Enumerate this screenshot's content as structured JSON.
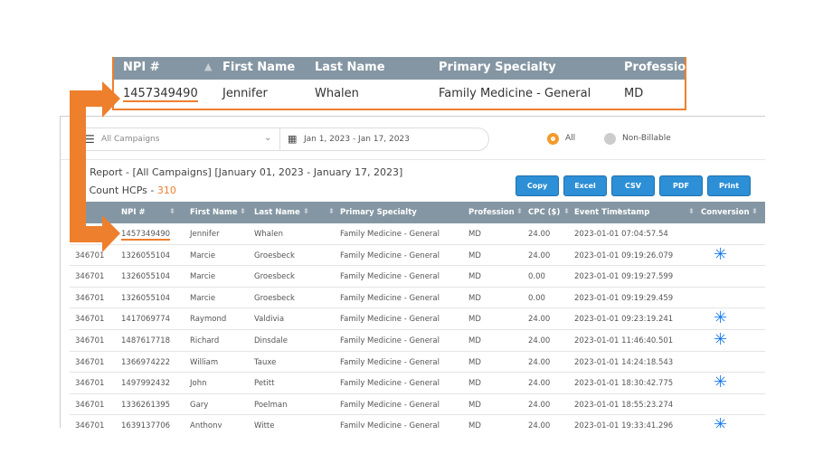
{
  "callout": {
    "headers": [
      "NPI #",
      "First Name",
      "Last Name",
      "Primary Specialty",
      "Profession"
    ],
    "row": {
      "npi": "1457349490",
      "first": "Jennifer",
      "last": "Whalen",
      "specialty": "Family Medicine - General",
      "profession": "MD"
    }
  },
  "filters": {
    "campaign": "All Campaigns",
    "date_range": "Jan 1, 2023 - Jan 17, 2023",
    "radio_all": "All",
    "radio_nonbillable": "Non-Billable",
    "selected": "All"
  },
  "report": {
    "title": "LD Report - [All Campaigns] [January 01, 2023 - January 17, 2023]",
    "count_label": "tal Count HCPs - ",
    "count_value": "310"
  },
  "buttons": [
    "Copy",
    "Excel",
    "CSV",
    "PDF",
    "Print"
  ],
  "table": {
    "headers": [
      "ID",
      "NPI #",
      "First Name",
      "Last Name",
      "Primary Specialty",
      "Profession",
      "CPC ($)",
      "Event Timestamp",
      "Conversion"
    ],
    "rows": [
      {
        "id": "",
        "npi": "1457349490",
        "first": "Jennifer",
        "last": "Whalen",
        "spec": "Family Medicine - General",
        "prof": "MD",
        "cpc": "24.00",
        "ts": "2023-01-01 07:04:57.54",
        "conv": false
      },
      {
        "id": "346701",
        "npi": "1326055104",
        "first": "Marcie",
        "last": "Groesbeck",
        "spec": "Family Medicine - General",
        "prof": "MD",
        "cpc": "24.00",
        "ts": "2023-01-01 09:19:26.079",
        "conv": true
      },
      {
        "id": "346701",
        "npi": "1326055104",
        "first": "Marcie",
        "last": "Groesbeck",
        "spec": "Family Medicine - General",
        "prof": "MD",
        "cpc": "0.00",
        "ts": "2023-01-01 09:19:27.599",
        "conv": false
      },
      {
        "id": "346701",
        "npi": "1326055104",
        "first": "Marcie",
        "last": "Groesbeck",
        "spec": "Family Medicine - General",
        "prof": "MD",
        "cpc": "0.00",
        "ts": "2023-01-01 09:19:29.459",
        "conv": false
      },
      {
        "id": "346701",
        "npi": "1417069774",
        "first": "Raymond",
        "last": "Valdivia",
        "spec": "Family Medicine - General",
        "prof": "MD",
        "cpc": "24.00",
        "ts": "2023-01-01 09:23:19.241",
        "conv": true
      },
      {
        "id": "346701",
        "npi": "1487617718",
        "first": "Richard",
        "last": "Dinsdale",
        "spec": "Family Medicine - General",
        "prof": "MD",
        "cpc": "24.00",
        "ts": "2023-01-01 11:46:40.501",
        "conv": true
      },
      {
        "id": "346701",
        "npi": "1366974222",
        "first": "William",
        "last": "Tauxe",
        "spec": "Family Medicine - General",
        "prof": "MD",
        "cpc": "24.00",
        "ts": "2023-01-01 14:24:18.543",
        "conv": false
      },
      {
        "id": "346701",
        "npi": "1497992432",
        "first": "John",
        "last": "Petitt",
        "spec": "Family Medicine - General",
        "prof": "MD",
        "cpc": "24.00",
        "ts": "2023-01-01 18:30:42.775",
        "conv": true
      },
      {
        "id": "346701",
        "npi": "1336261395",
        "first": "Gary",
        "last": "Poelman",
        "spec": "Family Medicine - General",
        "prof": "MD",
        "cpc": "24.00",
        "ts": "2023-01-01 18:55:23.274",
        "conv": false
      },
      {
        "id": "346701",
        "npi": "1639137706",
        "first": "Anthony",
        "last": "Witte",
        "spec": "Family Medicine - General",
        "prof": "MD",
        "cpc": "24.00",
        "ts": "2023-01-01 19:33:41.296",
        "conv": true
      }
    ]
  },
  "colors": {
    "accent": "#ee7f2d",
    "header_bg": "#8496a3",
    "button": "#2d8fd5",
    "conversion": "#1a7cf0"
  },
  "icons": {
    "conversion": "asterisk-icon",
    "sort": "sort-icon",
    "calendar": "calendar-icon",
    "menu": "menu-icon",
    "dropdown": "chevron-down-icon"
  }
}
